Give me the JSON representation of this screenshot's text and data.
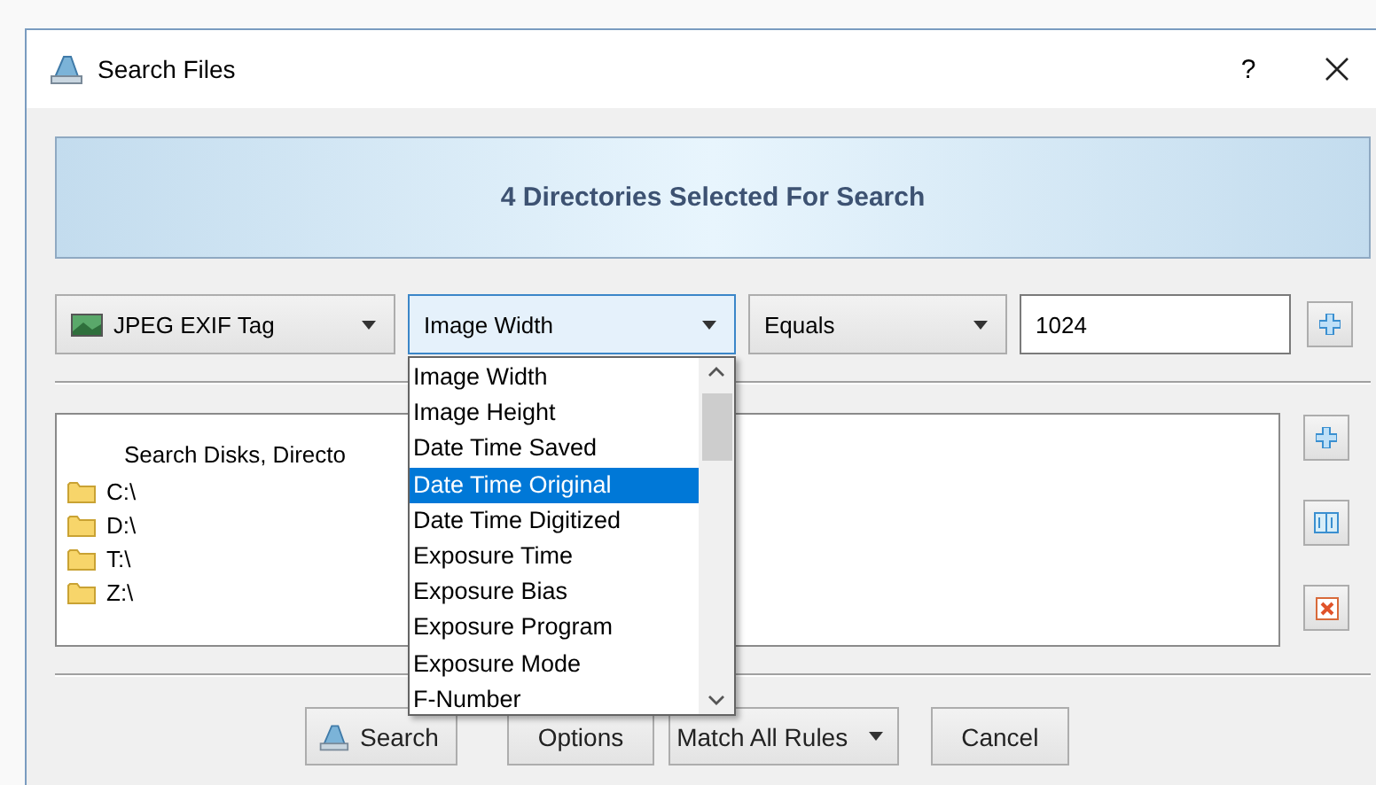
{
  "window": {
    "title": "Search Files",
    "help": "?"
  },
  "banner": "4 Directories Selected For Search",
  "rule": {
    "field_type": "JPEG EXIF Tag",
    "field": "Image Width",
    "operator": "Equals",
    "value": "1024"
  },
  "field_dropdown": {
    "expanded": true,
    "items": [
      {
        "label": "Image Width",
        "selected": false
      },
      {
        "label": "Image Height",
        "selected": false
      },
      {
        "label": "Date Time Saved",
        "selected": false
      },
      {
        "label": "Date Time Original",
        "selected": true
      },
      {
        "label": "Date Time Digitized",
        "selected": false
      },
      {
        "label": "Exposure Time",
        "selected": false
      },
      {
        "label": "Exposure Bias",
        "selected": false
      },
      {
        "label": "Exposure Program",
        "selected": false
      },
      {
        "label": "Exposure Mode",
        "selected": false
      },
      {
        "label": "F-Number",
        "selected": false
      }
    ]
  },
  "locations": {
    "header": "Search Disks, Directo",
    "items": [
      "C:\\",
      "D:\\",
      "T:\\",
      "Z:\\"
    ]
  },
  "buttons": [
    {
      "label": "Search",
      "kind": "icon"
    },
    {
      "label": "Options",
      "kind": "plain"
    },
    {
      "label": "Match All Rules",
      "kind": "menu"
    },
    {
      "label": "Cancel",
      "kind": "plain"
    }
  ]
}
